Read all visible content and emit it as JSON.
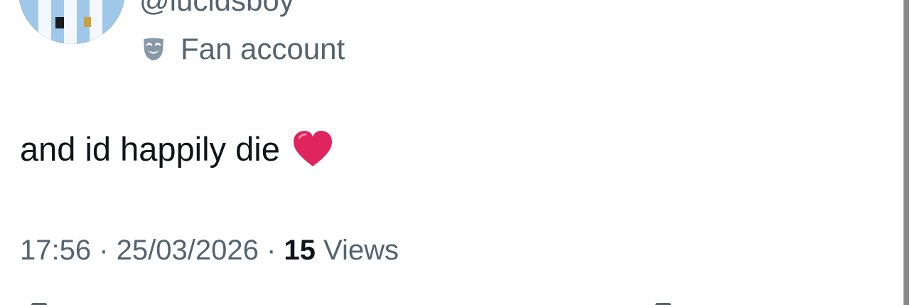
{
  "user": {
    "handle": "@lucidsboy",
    "label_text": "Fan account",
    "label_icon": "theater-mask-icon"
  },
  "tweet": {
    "text": "and id happily die",
    "emoji": "red-heart-icon"
  },
  "meta": {
    "time": "17:56",
    "separator1": " · ",
    "date": "25/03/2026",
    "separator2": " · ",
    "views_count": "15",
    "views_label": " Views"
  },
  "colors": {
    "secondary_text": "#536471",
    "primary_text": "#0f1419",
    "heart": "#e0245e"
  }
}
